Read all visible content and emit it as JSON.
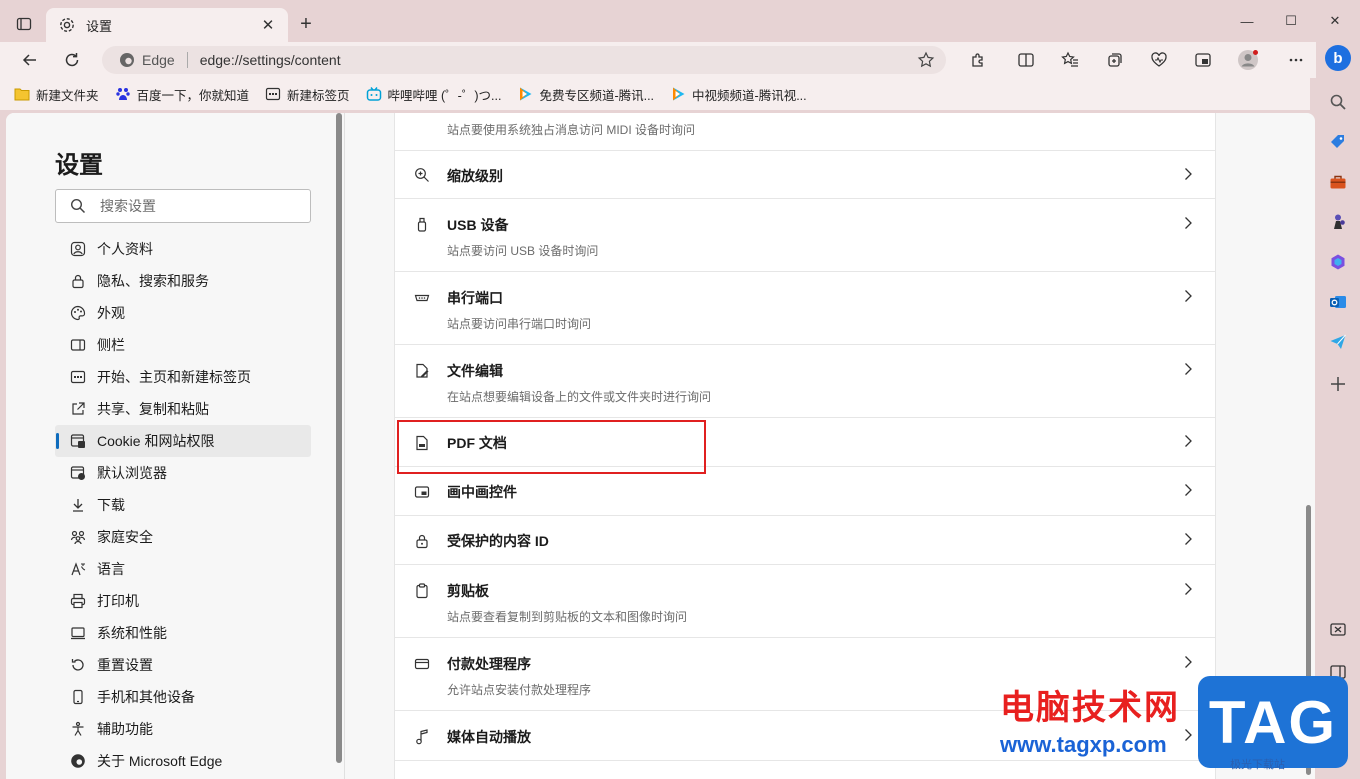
{
  "tab": {
    "title": "设置",
    "close": "✕"
  },
  "new_tab_glyph": "+",
  "window": {
    "minimize": "—",
    "maximize": "☐",
    "close": "✕"
  },
  "address": {
    "site_label": "Edge",
    "url": "edge://settings/content"
  },
  "bookmarks": [
    {
      "label": "新建文件夹",
      "icon": "folder-icon"
    },
    {
      "label": "百度一下，你就知道",
      "icon": "baidu-icon"
    },
    {
      "label": "新建标签页",
      "icon": "new-tab-page-icon"
    },
    {
      "label": "哔哩哔哩 (゜-゜)つ...",
      "icon": "bilibili-icon"
    },
    {
      "label": "免费专区频道-腾讯...",
      "icon": "tencent-video-icon"
    },
    {
      "label": "中视频频道-腾讯视...",
      "icon": "tencent-video-icon"
    }
  ],
  "nav": {
    "title": "设置",
    "search_placeholder": "搜索设置",
    "items": [
      {
        "label": "个人资料",
        "icon": "profile-icon"
      },
      {
        "label": "隐私、搜索和服务",
        "icon": "lock-icon"
      },
      {
        "label": "外观",
        "icon": "palette-icon"
      },
      {
        "label": "侧栏",
        "icon": "sidebar-icon"
      },
      {
        "label": "开始、主页和新建标签页",
        "icon": "home-page-icon"
      },
      {
        "label": "共享、复制和粘贴",
        "icon": "share-icon"
      },
      {
        "label": "Cookie 和网站权限",
        "icon": "site-permissions-icon",
        "active": true
      },
      {
        "label": "默认浏览器",
        "icon": "default-browser-icon"
      },
      {
        "label": "下载",
        "icon": "download-icon"
      },
      {
        "label": "家庭安全",
        "icon": "family-icon"
      },
      {
        "label": "语言",
        "icon": "language-icon"
      },
      {
        "label": "打印机",
        "icon": "printer-icon"
      },
      {
        "label": "系统和性能",
        "icon": "system-icon"
      },
      {
        "label": "重置设置",
        "icon": "reset-icon"
      },
      {
        "label": "手机和其他设备",
        "icon": "phone-icon"
      },
      {
        "label": "辅助功能",
        "icon": "accessibility-icon"
      },
      {
        "label": "关于 Microsoft Edge",
        "icon": "edge-logo-icon"
      }
    ]
  },
  "permissions": {
    "top_partial_sub": "站点要使用系统独占消息访问 MIDI 设备时询问",
    "rows": [
      {
        "title": "缩放级别",
        "sub": "",
        "icon": "zoom-icon"
      },
      {
        "title": "USB 设备",
        "sub": "站点要访问 USB 设备时询问",
        "icon": "usb-icon"
      },
      {
        "title": "串行端口",
        "sub": "站点要访问串行端口时询问",
        "icon": "serial-port-icon"
      },
      {
        "title": "文件编辑",
        "sub": "在站点想要编辑设备上的文件或文件夹时进行询问",
        "icon": "file-edit-icon"
      },
      {
        "title": "PDF 文档",
        "sub": "",
        "icon": "pdf-icon"
      },
      {
        "title": "画中画控件",
        "sub": "",
        "icon": "picture-in-picture-icon"
      },
      {
        "title": "受保护的内容 ID",
        "sub": "",
        "icon": "protected-content-icon"
      },
      {
        "title": "剪贴板",
        "sub": "站点要查看复制到剪贴板的文本和图像时询问",
        "icon": "clipboard-icon"
      },
      {
        "title": "付款处理程序",
        "sub": "允许站点安装付款处理程序",
        "icon": "payment-icon"
      },
      {
        "title": "媒体自动播放",
        "sub": "",
        "icon": "media-autoplay-icon"
      }
    ]
  },
  "watermark": {
    "cn": "电脑技术网",
    "url": "www.tagxp.com",
    "tag": "TAG",
    "small": "极光下载站"
  },
  "colors": {
    "accent": "#0f6cbd",
    "highlight": "#e02020",
    "frame": "#e7d3d4"
  }
}
